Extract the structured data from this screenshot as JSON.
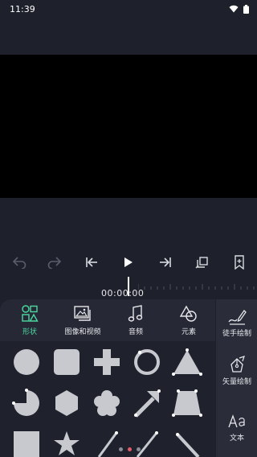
{
  "status_bar": {
    "time": "11:39",
    "icons": [
      "wifi-icon",
      "battery-icon"
    ]
  },
  "playback": {
    "buttons": [
      "undo-icon",
      "redo-icon",
      "skip-to-start-icon",
      "play-icon",
      "skip-to-end-icon",
      "crop-icon",
      "bookmark-icon"
    ],
    "timecode": "00:00:00"
  },
  "categories": [
    {
      "label": "形状",
      "icon": "shapes-icon",
      "active": true
    },
    {
      "label": "图像和视频",
      "icon": "image-video-icon",
      "active": false
    },
    {
      "label": "音频",
      "icon": "music-note-icon",
      "active": false
    },
    {
      "label": "元素",
      "icon": "elements-icon",
      "active": false
    }
  ],
  "side_tools": [
    {
      "label": "徒手绘制",
      "icon": "freehand-draw-icon"
    },
    {
      "label": "矢量绘制",
      "icon": "vector-draw-icon"
    },
    {
      "label": "文本",
      "icon": "text-icon"
    }
  ],
  "shapes": [
    "circle",
    "rounded-square",
    "plus",
    "ring",
    "triangle",
    "pie",
    "hexagon",
    "flower",
    "arrow",
    "trapezoid",
    "square",
    "star",
    "line",
    "line",
    "diagonal-line"
  ],
  "colors": {
    "accent": "#4cd9a0",
    "shape_fill": "#c7c9cf",
    "page_dot_active": "#e65b6a"
  }
}
